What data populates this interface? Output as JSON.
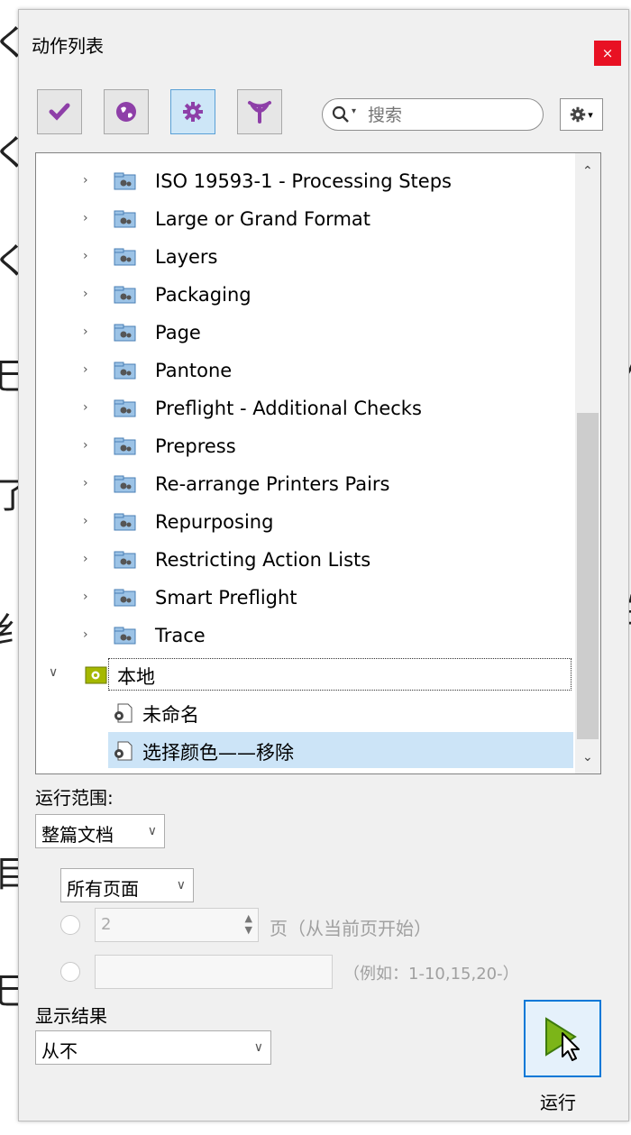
{
  "window": {
    "title": "动作列表",
    "close": "×"
  },
  "toolbar": {
    "buttons": [
      {
        "name": "check",
        "icon": "check-icon"
      },
      {
        "name": "globe",
        "icon": "globe-icon"
      },
      {
        "name": "gear",
        "icon": "gear-icon",
        "active": true
      },
      {
        "name": "filter",
        "icon": "filter-icon"
      }
    ],
    "search": {
      "placeholder": "搜索"
    }
  },
  "tree": {
    "items": [
      {
        "label": "ISO 19593-1 - Processing Steps",
        "level": 1,
        "expanded": false
      },
      {
        "label": "Large or Grand Format",
        "level": 1,
        "expanded": false
      },
      {
        "label": "Layers",
        "level": 1,
        "expanded": false
      },
      {
        "label": "Packaging",
        "level": 1,
        "expanded": false
      },
      {
        "label": "Page",
        "level": 1,
        "expanded": false
      },
      {
        "label": "Pantone",
        "level": 1,
        "expanded": false
      },
      {
        "label": "Preflight - Additional Checks",
        "level": 1,
        "expanded": false
      },
      {
        "label": "Prepress",
        "level": 1,
        "expanded": false
      },
      {
        "label": "Re-arrange Printers Pairs",
        "level": 1,
        "expanded": false
      },
      {
        "label": "Repurposing",
        "level": 1,
        "expanded": false
      },
      {
        "label": "Restricting Action Lists",
        "level": 1,
        "expanded": false
      },
      {
        "label": "Smart Preflight",
        "level": 1,
        "expanded": false
      },
      {
        "label": "Trace",
        "level": 1,
        "expanded": false
      },
      {
        "label": "本地",
        "level": 0,
        "expanded": true,
        "focused": true
      },
      {
        "label": "未命名",
        "level": 2
      },
      {
        "label": "选择颜色——移除",
        "level": 2,
        "selected": true
      }
    ]
  },
  "run_scope": {
    "label": "运行范围:",
    "scope_value": "整篇文档",
    "pages_value": "所有页面",
    "page_number": "2",
    "page_suffix": "页（从当前页开始）",
    "range_hint": "（例如：1-10,15,20-）"
  },
  "show_results": {
    "label": "显示结果",
    "value": "从不"
  },
  "run_button": {
    "label": "运行"
  },
  "colors": {
    "accent": "#0078d7",
    "selection": "#cce4f7",
    "close": "#e81123"
  }
}
